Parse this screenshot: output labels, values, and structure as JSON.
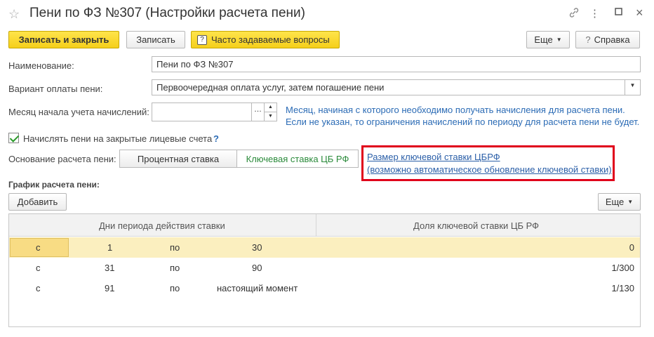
{
  "window": {
    "title": "Пени по ФЗ №307 (Настройки расчета пени)"
  },
  "toolbar": {
    "save_close": "Записать и закрыть",
    "save": "Записать",
    "faq": "Часто задаваемые вопросы",
    "more": "Еще",
    "help": "Справка"
  },
  "form": {
    "name_label": "Наименование:",
    "name_value": "Пени по ФЗ №307",
    "payment_label": "Вариант оплаты пени:",
    "payment_value": "Первоочередная оплата услуг, затем погашение пени",
    "month_label": "Месяц начала учета начислений:",
    "month_value": "",
    "month_help_1": "Месяц, начиная с которого необходимо получать начисления для расчета пени.",
    "month_help_2": "Если не указан, то ограничения начислений по периоду для расчета пени не будет.",
    "closed_accounts_label": "Начислять пени на закрытые лицевые счета",
    "closed_accounts_checked": true,
    "question_mark": "?",
    "basis_label": "Основание расчета пени:",
    "basis_options": [
      "Процентная ставка",
      "Ключевая ставка ЦБ РФ"
    ],
    "basis_selected": "Ключевая ставка ЦБ РФ",
    "link_1": "Размер ключевой ставки ЦБРФ",
    "link_2": "(возможно автоматическое обновление ключевой ставки)"
  },
  "schedule": {
    "title": "График расчета пени:",
    "add": "Добавить",
    "more": "Еще",
    "columns": [
      "Дни периода действия ставки",
      "Доля ключевой ставки ЦБ РФ"
    ],
    "rows": [
      {
        "from_word": "с",
        "from": "1",
        "to_word": "по",
        "to": "30",
        "share": "0"
      },
      {
        "from_word": "с",
        "from": "31",
        "to_word": "по",
        "to": "90",
        "share": "1/300"
      },
      {
        "from_word": "с",
        "from": "91",
        "to_word": "по",
        "to": "настоящий момент",
        "share": "1/130"
      }
    ]
  },
  "colors": {
    "accent_yellow": "#f5cf1b",
    "link_blue": "#2b5fa8",
    "highlight_red": "#e0001b",
    "selected_row": "#fbefbf"
  }
}
